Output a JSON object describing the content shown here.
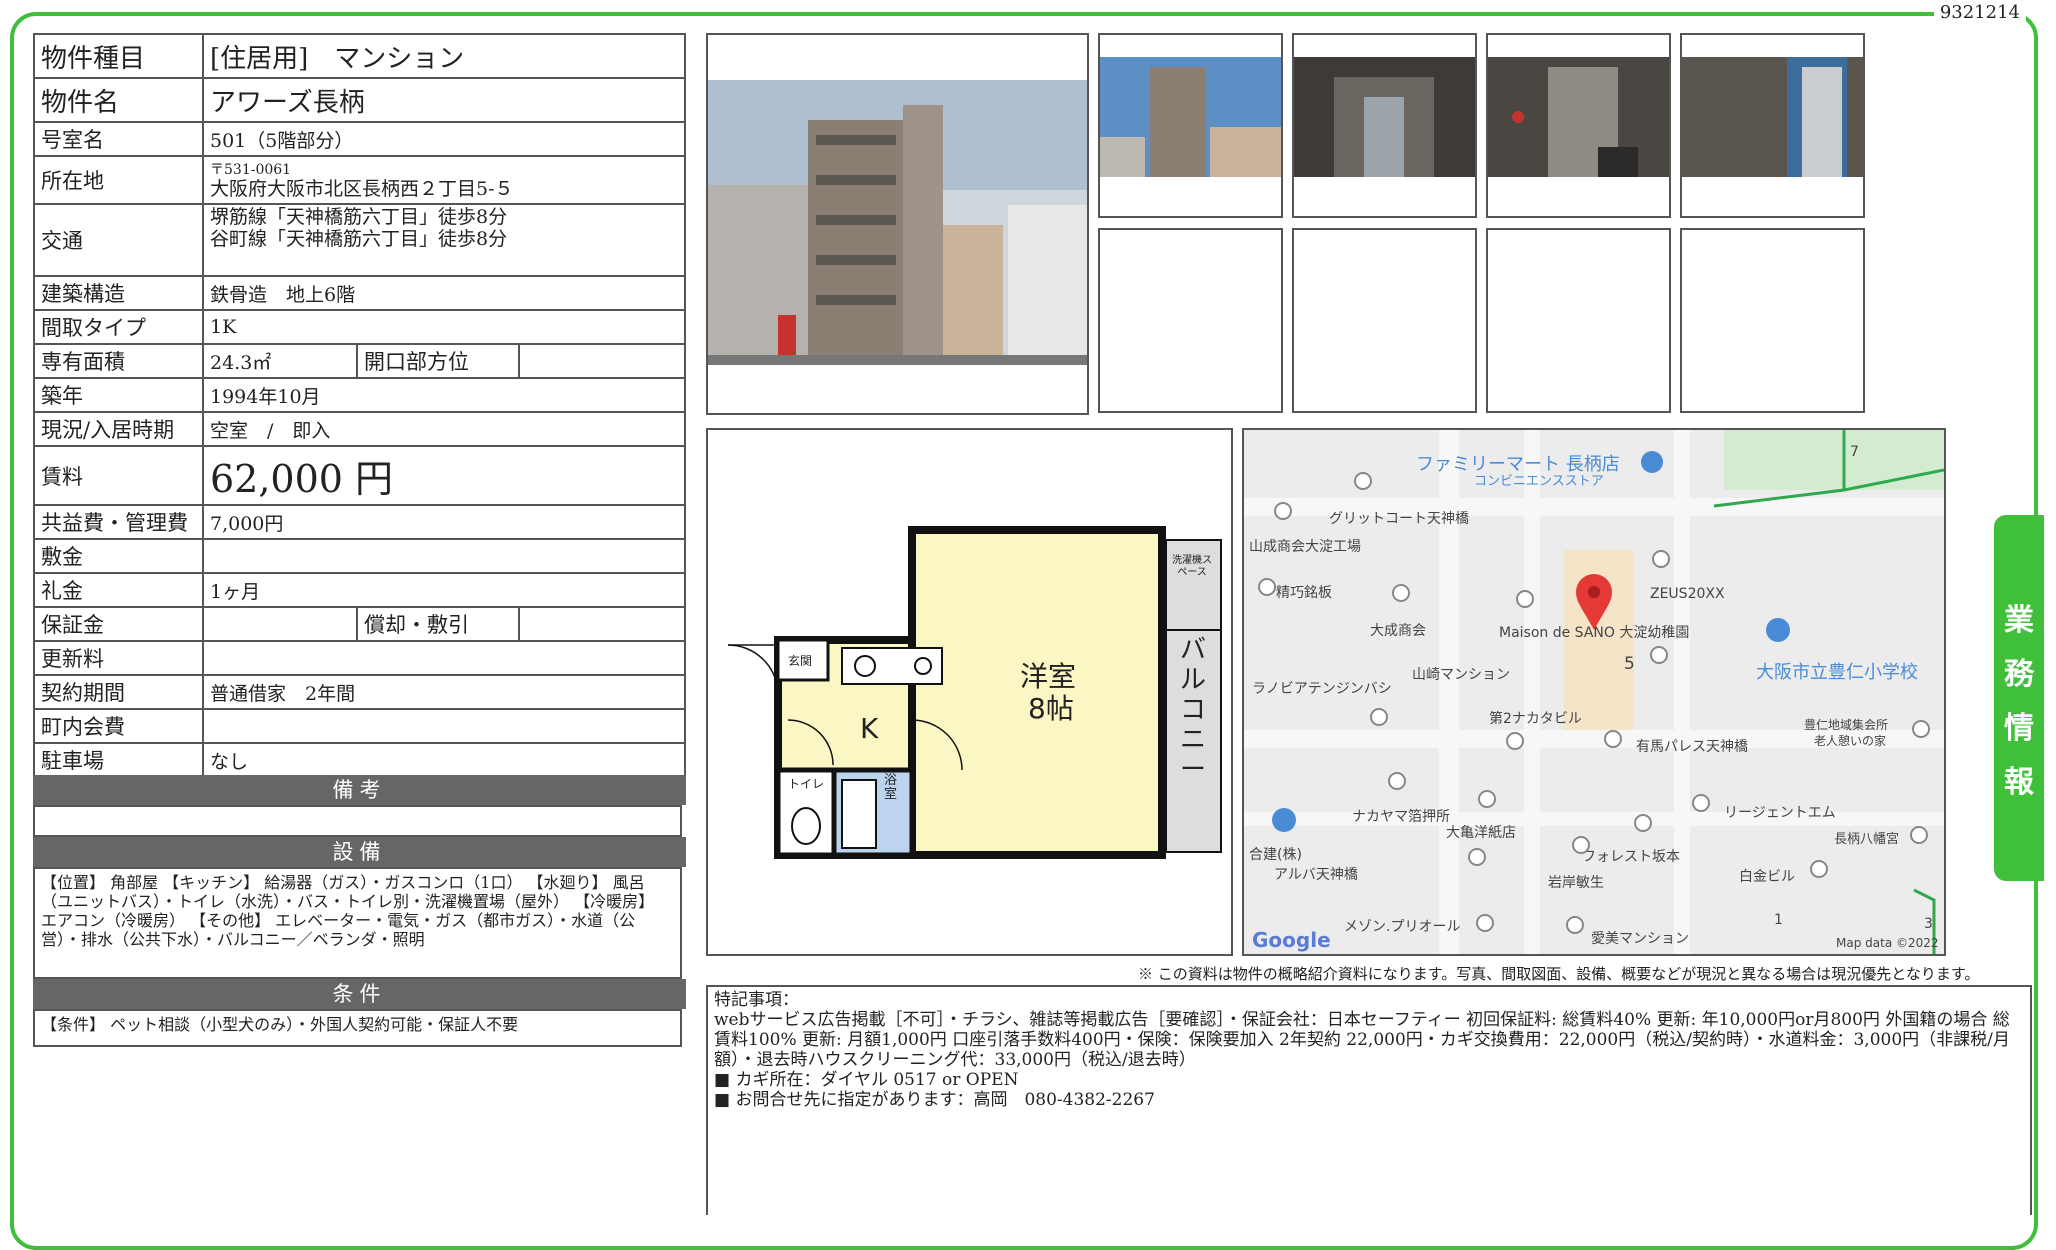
{
  "doc_id": "9321214",
  "side_tab": [
    "業",
    "務",
    "情",
    "報"
  ],
  "info": {
    "type_label": "物件種目",
    "type_value": "[住居用]　マンション",
    "name_label": "物件名",
    "name_value": "アワーズ長柄",
    "room_label": "号室名",
    "room_value": "501（5階部分）",
    "addr_label": "所在地",
    "addr_zip": "〒531-0061",
    "addr_value": "大阪府大阪市北区長柄西２丁目5-５",
    "access_label": "交通",
    "access_1": "堺筋線「天神橋筋六丁目」徒歩8分",
    "access_2": "谷町線「天神橋筋六丁目」徒歩8分",
    "struct_label": "建築構造",
    "struct_value": "鉄骨造　地上6階",
    "layout_label": "間取タイプ",
    "layout_value": "1K",
    "area_label": "専有面積",
    "area_value": "24.3㎡",
    "dir_label": "開口部方位",
    "dir_value": "",
    "built_label": "築年",
    "built_value": "1994年10月",
    "status_label": "現況/入居時期",
    "status_value": "空室　/　即入",
    "rent_label": "賃料",
    "rent_value": "62,000 円",
    "fee_label": "共益費・管理費",
    "fee_value": "7,000円",
    "deposit_label": "敷金",
    "deposit_value": "",
    "keymoney_label": "礼金",
    "keymoney_value": "1ヶ月",
    "guarantee_label": "保証金",
    "guarantee_value": "",
    "amort_label": "償却・敷引",
    "amort_value": "",
    "renew_label": "更新料",
    "renew_value": "",
    "contract_label": "契約期間",
    "contract_value": "普通借家　2年間",
    "town_label": "町内会費",
    "town_value": "",
    "parking_label": "駐車場",
    "parking_value": "なし"
  },
  "sections": {
    "biko": "備考",
    "setsubi": "設備",
    "joken": "条件"
  },
  "equipment_text": "【位置】 角部屋 【キッチン】 給湯器（ガス）・ガスコンロ（1口） 【水廻り】 風呂（ユニットバス）・トイレ（水洗）・バス・トイレ別・洗濯機置場（屋外） 【冷暖房】 エアコン（冷暖房） 【その他】 エレベーター・電気・ガス（都市ガス）・水道（公営）・排水（公共下水）・バルコニー／ベランダ・照明",
  "conditions_text": "【条件】 ペット相談（小型犬のみ）・外国人契約可能・保証人不要",
  "floorplan": {
    "room": "洋室",
    "room_size": "8帖",
    "kitchen": "K",
    "entrance": "玄関",
    "toilet": "トイレ",
    "bath": "浴室",
    "balcony": "バルコニー",
    "washer": "洗濯機スペース"
  },
  "map": {
    "labels": [
      "ファミリーマート 長柄店",
      "コンビニエンスストア",
      "グリットコート天神橋",
      "山成商会大淀工場",
      "精巧銘板",
      "大成商会",
      "ZEUS20XX",
      "Maison de SANO 大淀幼稚園",
      "大阪市立豊仁小学校",
      "ラノビアテンジンバシ",
      "山崎マンション",
      "第2ナカタビル",
      "有馬パレス天神橋",
      "豊仁地域集会所",
      "老人憩いの家",
      "ナカヤマ箔押所",
      "大亀洋紙店",
      "リージェントエム",
      "合建(株)",
      "フォレスト坂本",
      "長柄八幡宮",
      "アルバ天神橋",
      "岩岸敏生",
      "白金ビル",
      "メゾン.プリオール",
      "愛美マンション",
      "Google",
      "Map data ©2022",
      "5",
      "7",
      "1",
      "3"
    ]
  },
  "note": "※ この資料は物件の概略紹介資料になります。写真、間取図面、設備、概要などが現況と異なる場合は現況優先となります。",
  "remarks": {
    "title": "特記事項：",
    "line1": "webサービス広告掲載［不可］・チラシ、雑誌等掲載広告［要確認］・保証会社：日本セーフティー 初回保証料: 総賃料40% 更新: 年10,000円or月800円 外国籍の場合 総賃料100% 更新: 月額1,000円 口座引落手数料400円・保険：保険要加入 2年契約 22,000円・カギ交換費用：22,000円（税込/契約時）・水道料金：3,000円（非課税/月額）・退去時ハウスクリーニング代：33,000円（税込/退去時）",
    "line2": "■ カギ所在：ダイヤル 0517 or OPEN",
    "line3": "■ お問合せ先に指定があります：高岡　080-4382-2267"
  }
}
